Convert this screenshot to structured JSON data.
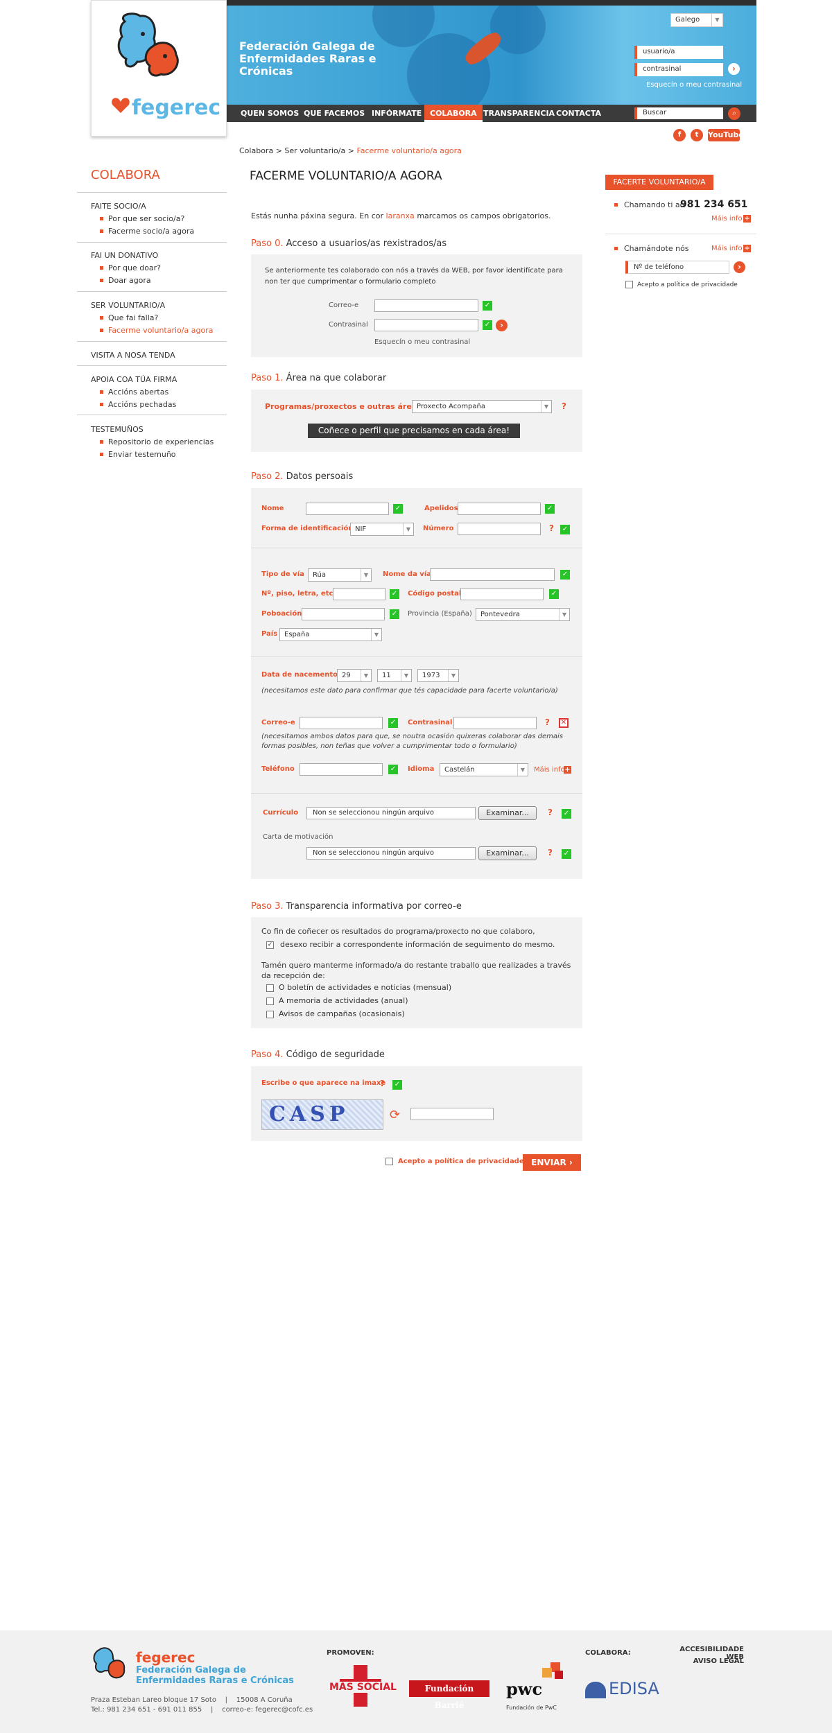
{
  "header": {
    "org_title": "Federación Galega de Enfermidades Raras e Crónicas",
    "language": "Galego",
    "username_placeholder": "usuario/a",
    "password_placeholder": "contrasinal",
    "forgot_password": "Esquecín o meu contrasinal",
    "search_placeholder": "Buscar",
    "youtube_label": "YouTube",
    "logo_text": "fegerec"
  },
  "nav": [
    "QUEN SOMOS",
    "QUE FACEMOS",
    "INFÓRMATE",
    "COLABORA",
    "TRANSPARENCIA",
    "CONTACTA"
  ],
  "breadcrumb": {
    "a": "Colabora",
    "b": "Ser voluntario/a",
    "c": "Facerme voluntario/a agora",
    "sep": ">"
  },
  "sidebar": {
    "title": "COLABORA",
    "s1": {
      "head": "FAITE SOCIO/A",
      "i1": "Por que ser socio/a?",
      "i2": "Facerme socio/a agora"
    },
    "s2": {
      "head": "FAI UN DONATIVO",
      "i1": "Por que doar?",
      "i2": "Doar agora"
    },
    "s3": {
      "head": "SER VOLUNTARIO/A",
      "i1": "Que fai falla?",
      "i2": "Facerme voluntario/a agora"
    },
    "s4": {
      "head": "VISITA A NOSA TENDA"
    },
    "s5": {
      "head": "APOIA COA TÚA FIRMA",
      "i1": "Accións abertas",
      "i2": "Accións pechadas"
    },
    "s6": {
      "head": "TESTEMUÑOS",
      "i1": "Repositorio de experiencias",
      "i2": "Enviar testemuño"
    }
  },
  "main": {
    "title": "FACERME VOLUNTARIO/A AGORA",
    "intro_a": "Estás nunha páxina segura. En cor",
    "intro_orange": "laranxa",
    "intro_b": "marcamos os campos obrigatorios.",
    "step0": {
      "num": "Paso 0.",
      "title": "Acceso a usuarios/as rexistrados/as",
      "text": "Se anteriormente tes colaborado con nós a través da WEB, por favor identifícate para non ter que cumprimentar o formulario completo",
      "email": "Correo-e",
      "password": "Contrasinal",
      "forgot": "Esquecín o meu contrasinal"
    },
    "step1": {
      "num": "Paso 1.",
      "title": "Área na que colaborar",
      "label": "Programas/proxectos e outras áreas",
      "value": "Proxecto Acompaña",
      "qmark": "?",
      "button": "Coñece o perfil que precisamos en cada área!"
    },
    "step2": {
      "num": "Paso 2.",
      "title": "Datos persoais",
      "nome": "Nome",
      "apelidos": "Apelidos",
      "forma": "Forma de identificación",
      "forma_val": "NIF",
      "numero": "Número",
      "tipo_via": "Tipo de vía",
      "tipo_via_val": "Rúa",
      "nome_via": "Nome da vía",
      "piso": "Nº, piso, letra, etc.",
      "cp": "Código postal",
      "poboacion": "Poboación",
      "provincia": "Provincia (España)",
      "provincia_val": "Pontevedra",
      "pais": "País",
      "pais_val": "España",
      "nacemento": "Data de nacemento",
      "day": "29",
      "month": "11",
      "year": "1973",
      "nacemento_note": "(necesitamos este dato para confirmar que tés capacidade para facerte voluntario/a)",
      "correo": "Correo-e",
      "contrasinal": "Contrasinal",
      "correo_note": "(necesitamos ambos datos para que, se noutra ocasión quixeras colaborar das demais formas posibles, non teñas que volver a cumprimentar todo o formulario)",
      "telefono": "Teléfono",
      "idioma": "Idioma",
      "idioma_val": "Castelán",
      "mais_info": "Máis info",
      "curriculo": "Currículo",
      "no_file": "Non se seleccionou ningún arquivo",
      "browse": "Examinar...",
      "carta": "Carta de motivación"
    },
    "step3": {
      "num": "Paso 3.",
      "title": "Transparencia informativa por correo-e",
      "p1": "Co fin de coñecer os resultados do programa/proxecto no que colaboro,",
      "c1": "desexo recibir a correspondente información de seguimento do mesmo.",
      "p2": "Tamén quero manterme informado/a do restante traballo que realizades a través da recepción de:",
      "o1": "O boletín de actividades e noticias (mensual)",
      "o2": "A memoria de actividades (anual)",
      "o3": "Avisos de campañas (ocasionais)"
    },
    "step4": {
      "num": "Paso 4.",
      "title": "Código de seguridade",
      "label": "Escribe o que aparece na imaxe",
      "captcha": "CASP"
    },
    "privacy": "Acepto a política de privacidade",
    "submit": "ENVIAR"
  },
  "right": {
    "vol_button": "FACERTE VOLUNTARIO/A",
    "call_text": "Chamando ti ao",
    "call_number": "981 234 651",
    "mais_info": "Máis info",
    "callback_text": "Chamándote nós",
    "phone_placeholder": "Nº de teléfono",
    "privacy": "Acepto a política de privacidade"
  },
  "footer": {
    "logo": "fegerec",
    "org_line1": "Federación Galega de",
    "org_line2": "Enfermidades Raras e Crónicas",
    "address": "Praza Esteban Lareo bloque 17 Soto    |    15008 A Coruña",
    "contact": "Tel.: 981 234 651 - 691 011 855    |    correo-e: fegerec@cofc.es",
    "promoven": "PROMOVEN:",
    "sponsor1": "MÁS SOCIAL",
    "sponsor2": "Fundación Barrié",
    "sponsor3": "pwc",
    "sponsor3_sub": "Fundación de PwC",
    "colabora": "COLABORA:",
    "sponsor4": "EDISA",
    "access": "ACCESIBILIDADE WEB",
    "legal": "AVISO LEGAL"
  }
}
